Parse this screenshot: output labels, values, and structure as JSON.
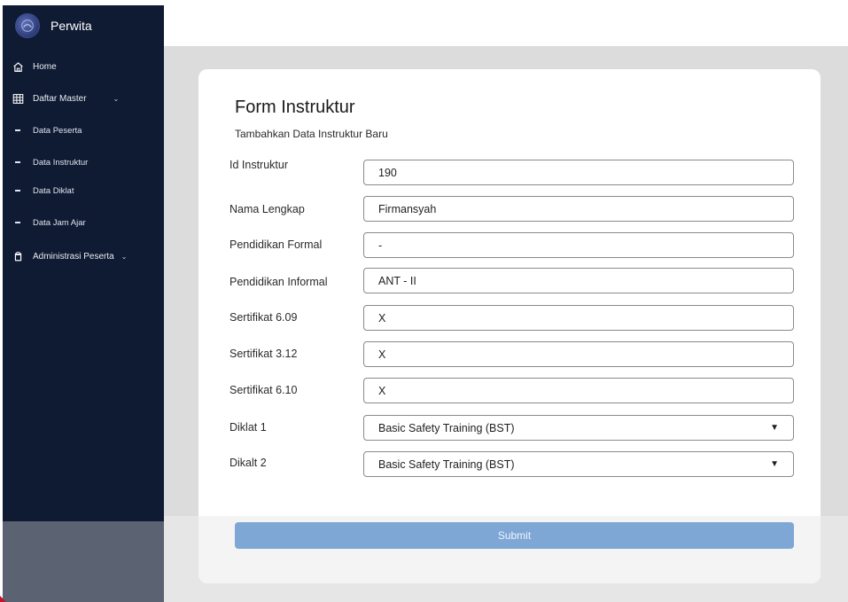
{
  "sidebar": {
    "brand": "Perwita",
    "items": [
      {
        "label": "Home",
        "icon": "home-icon"
      },
      {
        "label": "Daftar Master",
        "icon": "grid-icon",
        "expanded": true
      },
      {
        "label": "Data Peserta"
      },
      {
        "label": "Data Instruktur"
      },
      {
        "label": "Data Diklat"
      },
      {
        "label": "Data Jam Ajar"
      },
      {
        "label": "Administrasi Peserta",
        "icon": "clipboard-icon",
        "expanded": false
      }
    ],
    "chevron": "⌄"
  },
  "form": {
    "title": "Form Instruktur",
    "subtitle": "Tambahkan Data Instruktur Baru",
    "fields": [
      {
        "label": "Id Instruktur",
        "value": "190"
      },
      {
        "label": "Nama Lengkap",
        "value": "Firmansyah"
      },
      {
        "label": "Pendidikan Formal",
        "value": "-"
      },
      {
        "label": "Pendidikan Informal",
        "value": "ANT - II"
      },
      {
        "label": "Sertifikat 6.09",
        "value": "X"
      },
      {
        "label": "Sertifikat 3.12",
        "value": "X"
      },
      {
        "label": "Sertifikat 6.10",
        "value": "X"
      }
    ],
    "selects": [
      {
        "label": "Diklat 1",
        "value": "Basic Safety Training (BST)"
      },
      {
        "label": "Dikalt 2",
        "value": "Basic Safety Training (BST)"
      }
    ],
    "select_arrow": "▼",
    "submit_label": "Submit"
  },
  "colors": {
    "sidebar_bg": "#0f1a33",
    "submit_bg": "#7ea7d6",
    "content_bg": "#dcdcdc"
  }
}
